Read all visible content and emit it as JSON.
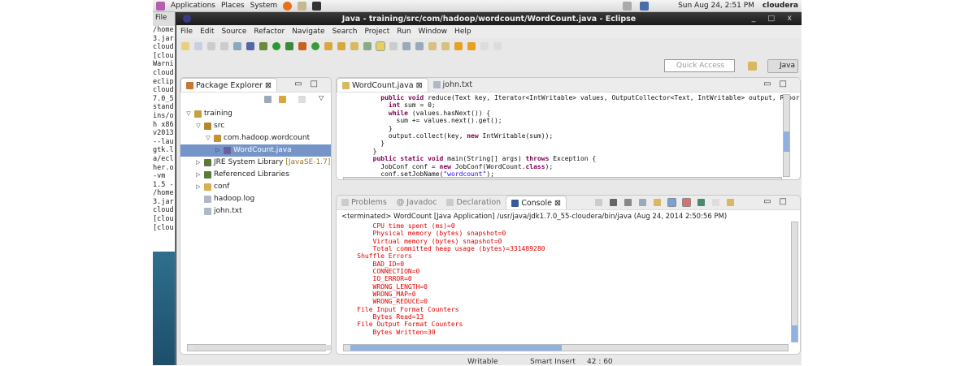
{
  "top_panel": {
    "menus": [
      "Applications",
      "Places",
      "System"
    ],
    "datetime": "Sun Aug 24,  2:51 PM",
    "user": "cloudera"
  },
  "terminal": {
    "menu": "File",
    "lines": [
      "/home",
      "3.jar",
      "cloud",
      "[clou",
      "Warni",
      "cloud",
      "eclip",
      "cloud",
      "7.0_5",
      "stand",
      "ins/o",
      "h x86",
      "v2013",
      "--lau",
      "gtk.l",
      "a/ecl",
      "her.o",
      " -vm",
      "1.5 -",
      "/home",
      "3.jar",
      "cloud",
      "[clou",
      "[clou"
    ]
  },
  "window": {
    "title": "Java - training/src/com/hadoop/wordcount/WordCount.java - Eclipse",
    "controls": "_ □ x"
  },
  "menu": [
    "File",
    "Edit",
    "Source",
    "Refactor",
    "Navigate",
    "Search",
    "Project",
    "Run",
    "Window",
    "Help"
  ],
  "quick_access": {
    "placeholder": "Quick Access"
  },
  "perspective": "Java",
  "package_explorer": {
    "title": "Package Explorer",
    "tree": [
      {
        "label": "training",
        "depth": 0,
        "twisty": "▽",
        "icon": "#c9a040"
      },
      {
        "label": "src",
        "depth": 1,
        "twisty": "▽",
        "icon": "#b8862a"
      },
      {
        "label": "com.hadoop.wordcount",
        "depth": 2,
        "twisty": "▽",
        "icon": "#c89030"
      },
      {
        "label": "WordCount.java",
        "depth": 3,
        "twisty": "▷",
        "icon": "#6a5fa0",
        "selected": true
      },
      {
        "label": "JRE System Library",
        "suffix": "[JavaSE-1.7]",
        "depth": 1,
        "twisty": "▷",
        "icon": "#5a7a3a"
      },
      {
        "label": "Referenced Libraries",
        "depth": 1,
        "twisty": "▷",
        "icon": "#5a7a3a"
      },
      {
        "label": "conf",
        "depth": 1,
        "twisty": "▷",
        "icon": "#d8b050"
      },
      {
        "label": "hadoop.log",
        "depth": 1,
        "twisty": "",
        "icon": "#b0b8c8"
      },
      {
        "label": "john.txt",
        "depth": 1,
        "twisty": "",
        "icon": "#b0b8c8"
      }
    ]
  },
  "editor": {
    "tabs": [
      "WordCount.java",
      "john.txt"
    ],
    "code": [
      [
        [
          "    "
        ],
        [
          "public void",
          "kw"
        ],
        [
          " reduce(Text key, Iterator<IntWritable> values, OutputCollector<Text, IntWritable> output, Reporter repor"
        ]
      ],
      [
        [
          "      "
        ],
        [
          "int",
          "kw"
        ],
        [
          " sum = 0;"
        ]
      ],
      [
        [
          "      "
        ],
        [
          "while",
          "kw"
        ],
        [
          " (values.hasNext()) {"
        ]
      ],
      [
        [
          "        sum += values.next().get();"
        ]
      ],
      [
        [
          "      }"
        ]
      ],
      [
        [
          "      output.collect(key, "
        ],
        [
          "new",
          "kw"
        ],
        [
          " IntWritable(sum));"
        ]
      ],
      [
        [
          "    }"
        ]
      ],
      [
        [
          "  }"
        ]
      ],
      [
        [
          "  "
        ],
        [
          "public static void",
          "kw"
        ],
        [
          " main(String[] args) "
        ],
        [
          "throws",
          "kw"
        ],
        [
          " Exception {"
        ]
      ],
      [
        [
          "    JobConf conf = "
        ],
        [
          "new",
          "kw"
        ],
        [
          " JobConf(WordCount."
        ],
        [
          "class",
          "kw"
        ],
        [
          ");"
        ]
      ],
      [
        [
          "    conf.setJobName("
        ],
        [
          "\"wordcount\"",
          "str"
        ],
        [
          ");"
        ]
      ]
    ]
  },
  "bottom": {
    "tabs": [
      "Problems",
      "Javadoc",
      "Declaration",
      "Console"
    ],
    "console_header": "<terminated> WordCount [Java Application] /usr/java/jdk1.7.0_55-cloudera/bin/java (Aug 24, 2014 2:50:56 PM)",
    "output": [
      "\t\tCPU time spent (ms)=0",
      "\t\tPhysical memory (bytes) snapshot=0",
      "\t\tVirtual memory (bytes) snapshot=0",
      "\t\tTotal committed heap usage (bytes)=331489280",
      "\tShuffle Errors",
      "\t\tBAD_ID=0",
      "\t\tCONNECTION=0",
      "\t\tIO_ERROR=0",
      "\t\tWRONG_LENGTH=0",
      "\t\tWRONG_MAP=0",
      "\t\tWRONG_REDUCE=0",
      "\tFile Input Format Counters ",
      "\t\tBytes Read=13",
      "\tFile Output Format Counters ",
      "\t\tBytes Written=30"
    ]
  },
  "status": {
    "writable": "Writable",
    "insert": "Smart Insert",
    "position": "42 : 60"
  }
}
